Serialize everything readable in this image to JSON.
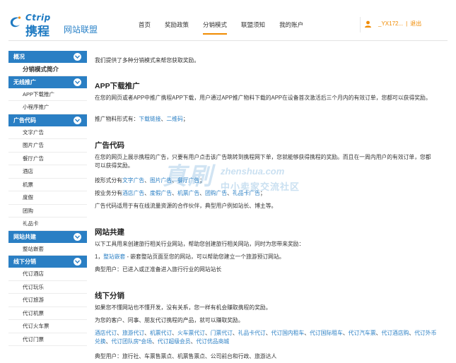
{
  "header": {
    "logo_en": "Ctrip",
    "logo_cn": "携程",
    "logo_sub": "网站联盟",
    "nav": [
      "首页",
      "奖励政策",
      "分销模式",
      "联盟须知",
      "我的账户"
    ],
    "user_name": "_YX172...",
    "separator": "|",
    "logout": "退出"
  },
  "sidebar": {
    "sections": [
      {
        "title": "概况",
        "items": [
          "分销模式简介"
        ]
      },
      {
        "title": "无线推广",
        "items": [
          "APP下载推广",
          "小程序推广"
        ]
      },
      {
        "title": "广告代码",
        "items": [
          "文字广告",
          "图片广告",
          "餐厅广告",
          "酒店",
          "机票",
          "度假",
          "团购",
          "礼品卡"
        ]
      },
      {
        "title": "网站共建",
        "items": [
          "整站嵌套"
        ]
      },
      {
        "title": "线下分销",
        "items": [
          "代订酒店",
          "代订玩乐",
          "代订旅游",
          "代订机票",
          "代订火车票",
          "代订门票"
        ]
      }
    ]
  },
  "main": {
    "intro": "我们提供了多种分销模式来帮您获取奖励。",
    "app": {
      "title": "APP下载推广",
      "desc": "在您的网页或者APP中推广携程APP下载，用户通过APP推广物料下载的APP在设备首次激活后三个月内的有效订单，您都可以获得奖励。",
      "forms_label": "推广物料形式有：",
      "forms_links": [
        "下载链接",
        "二维码"
      ],
      "sep": "、",
      "end": "；"
    },
    "ad": {
      "title": "广告代码",
      "desc": "在您的网页上展示携程的广告，只要有用户点击该广告跳转到携程网下单，您就能够获得携程的奖励。而且在一周内用户的有效订单，您都可以获得奖励。",
      "form_label": "按形式分有",
      "form_links": [
        "文字广告",
        "图片广告",
        "餐厅广告"
      ],
      "biz_label": "按业务分有",
      "biz_links": [
        "酒店广告",
        "度假广告",
        "机票广告",
        "团购广告",
        "礼品卡广告"
      ],
      "sep": "、",
      "end": "；",
      "note": "广告代码适用于有在线流量资源的合作伙伴，典型用户例如站长、博主等。"
    },
    "site": {
      "title": "网站共建",
      "desc": "以下工具用来创建旅行相关行业网站，帮助您创建旅行相关网站，同时为您带来奖励：",
      "item_prefix": "1，",
      "item_link": "整站嵌套",
      "item_rest": " - 嵌套整站页面至您的网站，可以帮助您建立一个旅游预订网站。",
      "typical": "典型用户：已进入或正准备进入旅行行业的网站站长"
    },
    "offline": {
      "title": "线下分销",
      "desc1": "如果您不懂网站也不懂开发，没有关系，您一样有机会赚取携程的奖励。",
      "desc2": "为您的客户、同事、朋友代订携程的产品，就可以赚取奖励。",
      "links": [
        "酒店代订",
        "旅游代订",
        "机票代订",
        "火车票代订",
        "门票代订",
        "礼品卡代订",
        "代订国内租车",
        "代订国际租车",
        "代订汽车票",
        "代订酒店购",
        "代订外币兑换",
        "代订团队房*会场",
        "代订超级会员",
        "代订优品商城"
      ],
      "sep": "、",
      "typical": "典型用户：旅行社、车票售票点、机票售票点、公司前台和行政、旅游达人"
    }
  },
  "watermark": {
    "big": "真刷",
    "url": "zhenshua.com",
    "sub": "中小卖家交流社区"
  },
  "colors": {
    "accent": "#2a7fc4",
    "orange": "#f08a00"
  }
}
